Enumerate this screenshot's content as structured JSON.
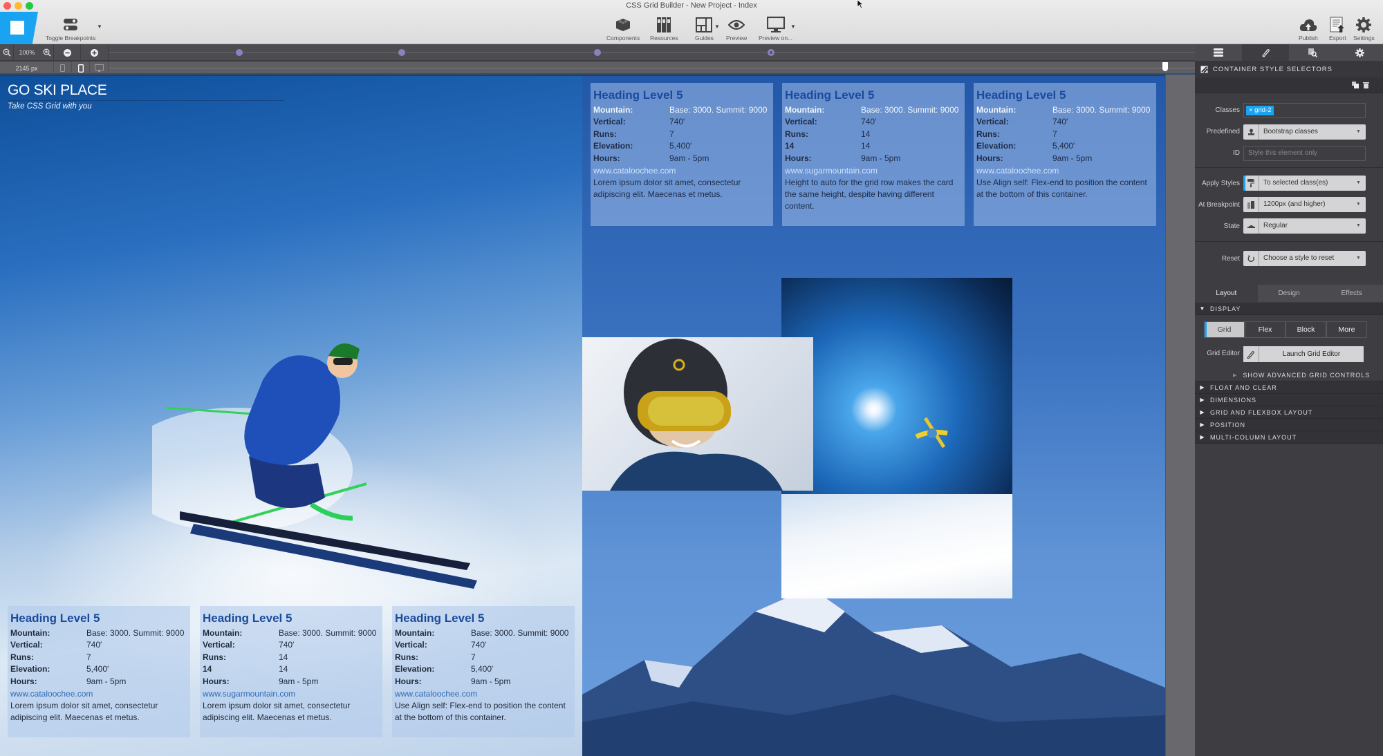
{
  "window": {
    "title": "CSS Grid Builder - New Project - Index"
  },
  "toolbar": {
    "toggle_breakpoints": "Toggle Breakpoints",
    "center_tools": [
      {
        "icon": "components-icon",
        "label": "Components"
      },
      {
        "icon": "resources-icon",
        "label": "Resources"
      },
      {
        "icon": "guides-icon",
        "label": "Guides"
      },
      {
        "icon": "preview-icon",
        "label": "Preview"
      },
      {
        "icon": "preview-on-icon",
        "label": "Preview on..."
      }
    ],
    "right_tools": [
      {
        "icon": "publish-icon",
        "label": "Publish"
      },
      {
        "icon": "export-icon",
        "label": "Export"
      },
      {
        "icon": "settings-icon",
        "label": "Settings"
      }
    ]
  },
  "zoombar": {
    "zoom_level": "100%",
    "canvas_width": "2145 px"
  },
  "breakpoints": [
    {
      "position_fraction": 0.12,
      "state": "filled"
    },
    {
      "position_fraction": 0.27,
      "state": "filled"
    },
    {
      "position_fraction": 0.45,
      "state": "filled"
    },
    {
      "position_fraction": 0.61,
      "state": "selected"
    }
  ],
  "site": {
    "title": "GO SKI PLACE",
    "subtitle": "Take CSS Grid with you",
    "top_cards": [
      {
        "heading": "Heading Level 5",
        "rows": [
          {
            "k": "Mountain:",
            "v": "Base: 3000. Summit: 9000"
          },
          {
            "k": "Vertical:",
            "v": "740′"
          },
          {
            "k": "Runs:",
            "v": "7"
          },
          {
            "k": "Elevation:",
            "v": "5,400′"
          },
          {
            "k": "Hours:",
            "v": "9am - 5pm"
          }
        ],
        "link": "www.cataloochee.com",
        "desc": "Lorem ipsum dolor sit amet, consectetur adipiscing elit. Maecenas et metus."
      },
      {
        "heading": "Heading Level 5",
        "rows": [
          {
            "k": "Mountain:",
            "v": "Base: 3000. Summit: 9000"
          },
          {
            "k": "Vertical:",
            "v": "740′"
          },
          {
            "k": "Runs:",
            "v": "14"
          },
          {
            "k": "14",
            "v": "14"
          },
          {
            "k": "Hours:",
            "v": "9am - 5pm"
          }
        ],
        "link": "www.sugarmountain.com",
        "desc": "Height to auto for the grid row makes the card the same height, despite having different content."
      },
      {
        "heading": "Heading Level 5",
        "rows": [
          {
            "k": "Mountain:",
            "v": "Base: 3000. Summit: 9000"
          },
          {
            "k": "Vertical:",
            "v": "740′"
          },
          {
            "k": "Runs:",
            "v": "7"
          },
          {
            "k": "Elevation:",
            "v": "5,400′"
          },
          {
            "k": "Hours:",
            "v": "9am - 5pm"
          }
        ],
        "link": "www.cataloochee.com",
        "desc": "Use Align self: Flex-end to position the content at the bottom of this container."
      }
    ],
    "bottom_cards": [
      {
        "heading": "Heading Level 5",
        "rows": [
          {
            "k": "Mountain:",
            "v": "Base: 3000. Summit: 9000"
          },
          {
            "k": "Vertical:",
            "v": "740′"
          },
          {
            "k": "Runs:",
            "v": "7"
          },
          {
            "k": "Elevation:",
            "v": "5,400′"
          },
          {
            "k": "Hours:",
            "v": "9am - 5pm"
          }
        ],
        "link": "www.cataloochee.com",
        "desc": "Lorem ipsum dolor sit amet, consectetur adipiscing elit. Maecenas et metus."
      },
      {
        "heading": "Heading Level 5",
        "rows": [
          {
            "k": "Mountain:",
            "v": "Base: 3000. Summit: 9000"
          },
          {
            "k": "Vertical:",
            "v": "740′"
          },
          {
            "k": "Runs:",
            "v": "14"
          },
          {
            "k": "14",
            "v": "14"
          },
          {
            "k": "Hours:",
            "v": "9am - 5pm"
          }
        ],
        "link": "www.sugarmountain.com",
        "desc": "Lorem ipsum dolor sit amet, consectetur adipiscing elit. Maecenas et metus."
      },
      {
        "heading": "Heading Level 5",
        "rows": [
          {
            "k": "Mountain:",
            "v": "Base: 3000. Summit: 9000"
          },
          {
            "k": "Vertical:",
            "v": "740′"
          },
          {
            "k": "Runs:",
            "v": "7"
          },
          {
            "k": "Elevation:",
            "v": "5,400′"
          },
          {
            "k": "Hours:",
            "v": "9am - 5pm"
          }
        ],
        "link": "www.cataloochee.com",
        "desc": "Use Align self: Flex-end to position the content at the bottom of this container."
      }
    ]
  },
  "panel": {
    "tabs": [
      "list-icon",
      "brush-icon",
      "inspect-icon",
      "gear-icon"
    ],
    "section_title": "CONTAINER STYLE SELECTORS",
    "classes_label": "Classes",
    "class_tag": "× grid-2",
    "predefined_label": "Predefined",
    "predefined_value": "Bootstrap classes",
    "id_label": "ID",
    "id_placeholder": "Style this element only",
    "apply_label": "Apply Styles",
    "apply_value": "To selected class(es)",
    "breakpoint_label": "At Breakpoint",
    "breakpoint_value": "1200px (and higher)",
    "state_label": "State",
    "state_value": "Regular",
    "reset_label": "Reset",
    "reset_value": "Choose a style to reset",
    "layout_tabs": [
      "Layout",
      "Design",
      "Effects"
    ],
    "display_heading": "DISPLAY",
    "display_buttons": [
      "Grid",
      "Flex",
      "Block",
      "More"
    ],
    "grid_editor_label": "Grid Editor",
    "launch_label": "Launch Grid Editor",
    "advanced_label": "SHOW ADVANCED GRID CONTROLS",
    "accordions": [
      "FLOAT AND CLEAR",
      "DIMENSIONS",
      "GRID AND FLEXBOX LAYOUT",
      "POSITION",
      "MULTI-COLUMN LAYOUT"
    ]
  },
  "colors": {
    "accent": "#1aa3f0",
    "breakpoint": "#8e7fbf",
    "heading": "#1b4a9c"
  }
}
